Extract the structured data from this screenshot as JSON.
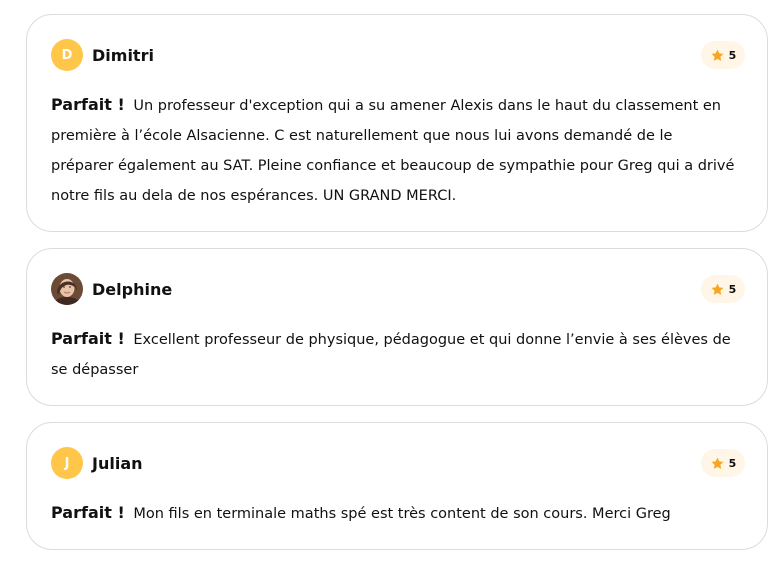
{
  "reviews": [
    {
      "author": "Dimitri",
      "initial": "D",
      "avatar": "initial",
      "rating": "5",
      "verdict": "Parfait !",
      "text": "Un professeur d'exception qui a su amener Alexis dans le haut du classement en première à l’école Alsacienne. C est naturellement que nous lui avons demandé de le préparer également au SAT. Pleine confiance et beaucoup de sympathie pour Greg qui a drivé notre fils au dela de nos espérances. UN GRAND MERCI."
    },
    {
      "author": "Delphine",
      "avatar": "photo",
      "rating": "5",
      "verdict": "Parfait !",
      "text": "Excellent professeur de physique, pédagogue et qui donne l’envie à ses élèves de se dépasser"
    },
    {
      "author": "Julian",
      "initial": "J",
      "avatar": "initial",
      "rating": "5",
      "verdict": "Parfait !",
      "text": "Mon fils en terminale maths spé est très content de son cours. Merci Greg"
    }
  ],
  "colors": {
    "avatar_bg": "#ffc64a",
    "star": "#f5a623",
    "rating_bg": "#fff6e8",
    "card_border": "#dcdcdc"
  },
  "icons": {
    "rating": "star-icon"
  }
}
